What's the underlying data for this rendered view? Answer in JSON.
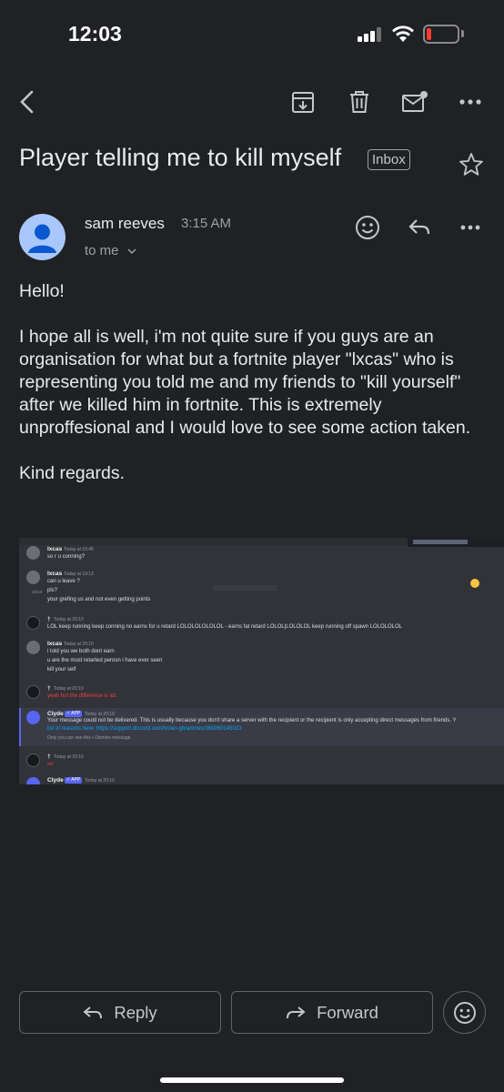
{
  "status_bar": {
    "time": "12:03"
  },
  "toolbar": {
    "back": "back-arrow-icon",
    "archive": "archive-icon",
    "delete": "trash-icon",
    "mark_unread": "mail-unread-icon",
    "more": "more-horizontal-icon"
  },
  "email": {
    "subject": "Player telling me to kill myself",
    "label": "Inbox",
    "sender_name": "sam reeves",
    "time": "3:15 AM",
    "recipient": "to me",
    "body": [
      "Hello!",
      "I hope all is well, i'm not quite sure if you guys are an organisation for what but a fortnite player \"lxcas\" who is representing you told me and my friends to \"kill yourself\" after we killed him in fortnite. This is extremely unproffesional and I would love to see some action taken.",
      "Kind regards."
    ]
  },
  "attachment": {
    "messages": [
      {
        "name": "lxcas",
        "stamp": "Today at 15:45",
        "lines": [
          "so r u conning?"
        ]
      },
      {
        "name": "lxcas",
        "stamp": "Today at 19:13",
        "lines": [
          "can u leave ?",
          "pls?",
          "your grefing us and not even getting points"
        ],
        "side_time": "19:13"
      },
      {
        "name": "†",
        "stamp": "Today at 20:10",
        "lines": [
          "LOL keep running keep conning no earns for u retard LOLOLOLOLOLOL - earns fat retard LOLOL|LOLOLOL keep running off spawn LOLOLOLOL"
        ]
      },
      {
        "name": "lxcas",
        "stamp": "Today at 20:10",
        "lines": [
          "i told you we both dont earn",
          "u are the most retarted perosn i have ever seen",
          "kill your self"
        ]
      },
      {
        "name": "†",
        "stamp": "Today at 20:10",
        "lines": [
          "yeah but the difference is idc"
        ]
      },
      {
        "name": "Clyde",
        "badge": "✓ APP",
        "stamp": "Today at 20:10",
        "lines": [
          "Your message could not be delivered. This is usually because you don't share a server with the recipient or the recipient is only accepting direct messages from friends. Y",
          "list of reasons here: https://support.discord.com/hc/en-gb/articles/360060145013",
          "Only you can see this • Dismiss message"
        ]
      },
      {
        "name": "†",
        "stamp": "Today at 20:10",
        "lines": [
          "so"
        ]
      },
      {
        "name": "Clyde",
        "badge": "✓ APP",
        "stamp": "Today at 20:10",
        "lines": []
      }
    ]
  },
  "actions": {
    "reply_label": "Reply",
    "forward_label": "Forward"
  }
}
